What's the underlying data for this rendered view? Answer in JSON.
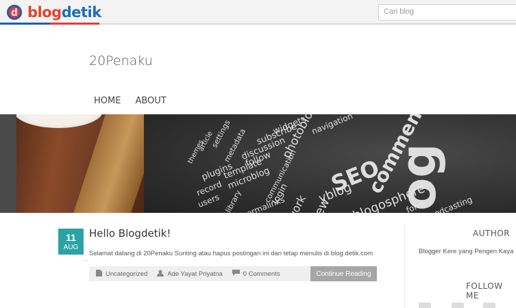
{
  "topbar": {
    "logo_letter": "d",
    "logo_part1": "blog",
    "logo_part2": "detik",
    "search_placeholder": "Cari blog",
    "stripe_colors": [
      "#1b5fb0",
      "#e23b3b"
    ]
  },
  "site": {
    "title": "20Penaku",
    "nav": [
      "HOME",
      "ABOUT"
    ]
  },
  "banner": {
    "words": [
      "themes",
      "article",
      "settings",
      "metadata",
      "subscribe",
      "discussion",
      "follow",
      "template",
      "widgets",
      "photoblog",
      "navigation",
      "SEO",
      "comments",
      "vblog",
      "blog",
      "plugins",
      "record",
      "users",
      "microblog",
      "library",
      "permalinks",
      "communication",
      "login",
      "work",
      "new",
      "blogosphere",
      "form",
      "podcasting"
    ]
  },
  "post": {
    "day": "11",
    "month": "AUG",
    "title": "Hello Blogdetik!",
    "excerpt": "Selamat datang di 20Penaku Sunting atau hapus postingan ini dan tetap menulis di blog.detik.com",
    "category": "Uncategorized",
    "author": "Ade Yayat Priyatna",
    "comments": "0 Comments",
    "continue_label": "Continue Reading"
  },
  "sidebar": {
    "author_heading": "AUTHOR",
    "author_bio": "Blogger Kere yang Pengen Kaya",
    "follow_heading": "FOLLOW ME"
  },
  "colors": {
    "accent": "#2ba3a5",
    "button": "#a6a6a6",
    "meta_bg": "#efefef"
  },
  "icons": [
    "folder-icon",
    "user-icon",
    "comment-icon"
  ]
}
